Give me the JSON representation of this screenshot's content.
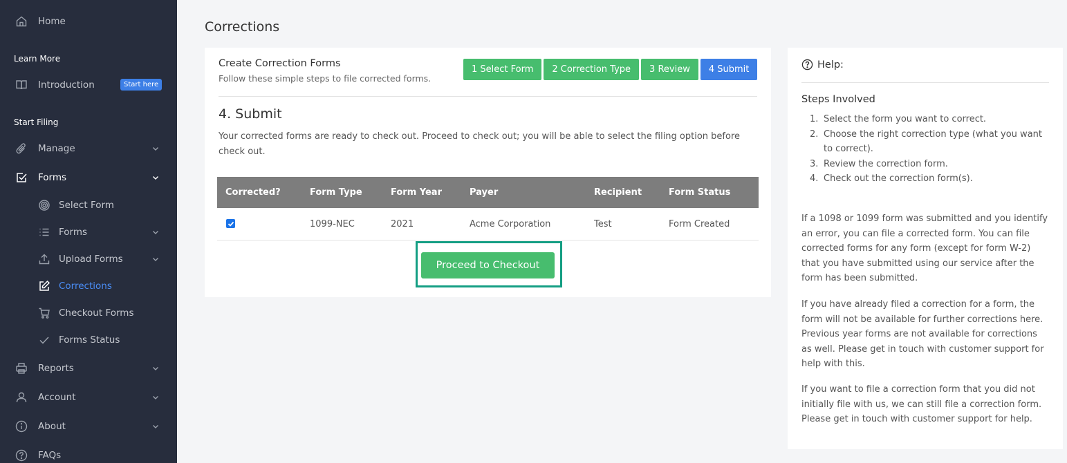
{
  "sidebar": {
    "home": "Home",
    "learn_more": "Learn More",
    "introduction": "Introduction",
    "start_here": "Start here",
    "start_filing": "Start Filing",
    "manage": "Manage",
    "forms": "Forms",
    "sub": {
      "select_form": "Select Form",
      "forms": "Forms",
      "upload_forms": "Upload Forms",
      "corrections": "Corrections",
      "checkout_forms": "Checkout Forms",
      "forms_status": "Forms Status"
    },
    "reports": "Reports",
    "account": "Account",
    "about": "About",
    "faqs": "FAQs"
  },
  "page": {
    "title": "Corrections"
  },
  "card": {
    "title": "Create Correction Forms",
    "subtitle": "Follow these simple steps to file corrected forms.",
    "steps": [
      "1 Select Form",
      "2 Correction Type",
      "3 Review",
      "4 Submit"
    ],
    "section_title": "4. Submit",
    "description": "Your corrected forms are ready to check out. Proceed to check out; you will be able to select the filing option before check out."
  },
  "table": {
    "headers": [
      "Corrected?",
      "Form Type",
      "Form Year",
      "Payer",
      "Recipient",
      "Form Status"
    ],
    "rows": [
      {
        "corrected": true,
        "form_type": "1099-NEC",
        "form_year": "2021",
        "payer": "Acme Corporation",
        "recipient": "Test",
        "status": "Form Created"
      }
    ]
  },
  "checkout_button": "Proceed to Checkout",
  "help": {
    "title": "Help:",
    "steps_title": "Steps Involved",
    "steps": [
      "Select the form you want to correct.",
      "Choose the right correction type (what you want to correct).",
      "Review the correction form.",
      "Check out the correction form(s)."
    ],
    "p1": "If a 1098 or 1099 form was submitted and you identify an error, you can file a corrected form. You can file corrected forms for any form (except for form W-2) that you have submitted using our service after the form has been submitted.",
    "p2": "If you have already filed a correction for a form, the form will not be available for further corrections here. Previous year forms are not available for corrections as well. Please get in touch with customer support for help with this.",
    "p3": "If you want to file a correction form that you did not initially file with us, we can still file a correction form. Please get in touch with customer support for help."
  },
  "colors": {
    "sidebar_bg": "#272d3d",
    "accent_blue": "#3d7fe6",
    "step_green": "#47bd6e",
    "highlight": "#149e83"
  }
}
